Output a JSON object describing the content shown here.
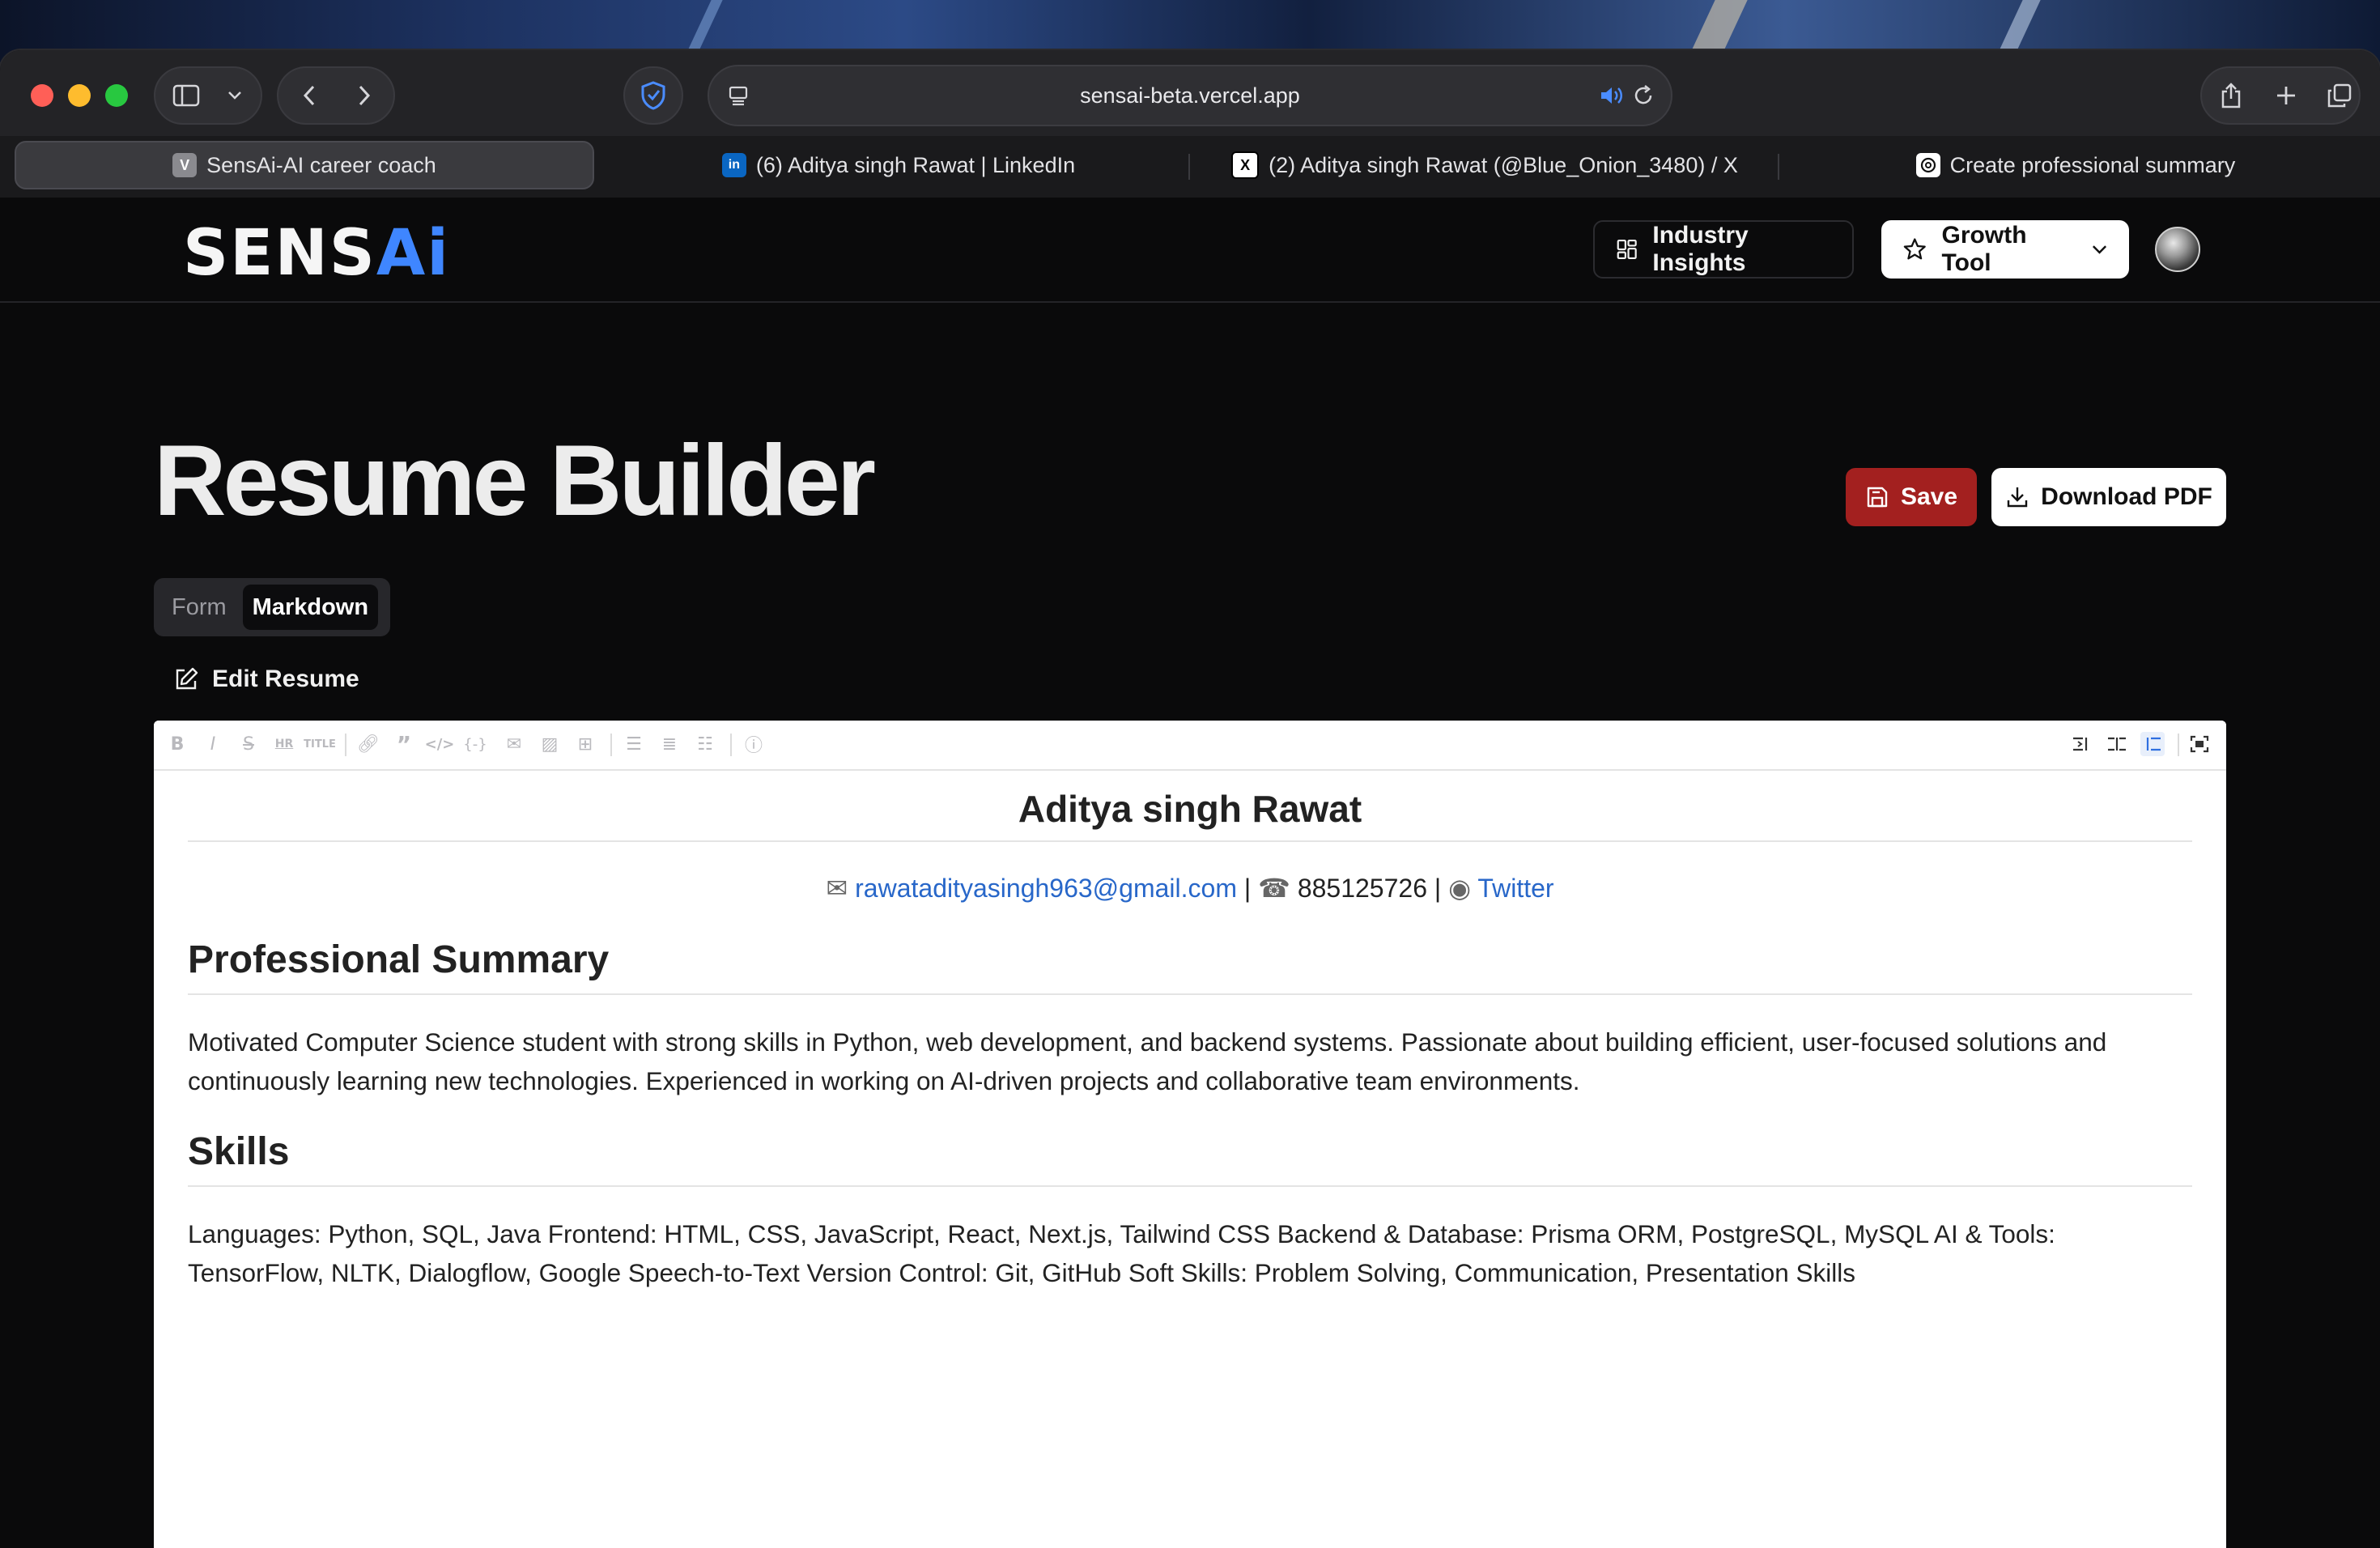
{
  "browser": {
    "url": "sensai-beta.vercel.app",
    "tabs": [
      {
        "label": "SensAi-AI career coach",
        "favicon": "V",
        "active": true
      },
      {
        "label": "(6) Aditya singh Rawat | LinkedIn",
        "favicon": "in",
        "active": false
      },
      {
        "label": "(2) Aditya singh Rawat (@Blue_Onion_3480) / X",
        "favicon": "X",
        "active": false
      },
      {
        "label": "Create professional summary",
        "favicon": "chatgpt-icon",
        "active": false
      }
    ]
  },
  "header": {
    "logo_main": "SENS",
    "logo_accent": "Ai",
    "industry_insights": "Industry Insights",
    "growth_tool": "Growth Tool"
  },
  "page": {
    "title": "Resume Builder",
    "save_label": "Save",
    "download_label": "Download PDF",
    "mode_tabs": [
      "Form",
      "Markdown"
    ],
    "active_mode": "Markdown",
    "edit_resume": "Edit Resume"
  },
  "resume": {
    "name": "Aditya singh Rawat",
    "email": "rawatadityasingh963@gmail.com",
    "phone": "885125726",
    "twitter": "Twitter",
    "sep": "|",
    "summary_heading": "Professional Summary",
    "summary_text": "Motivated Computer Science student with strong skills in Python, web development, and backend systems. Passionate about building efficient, user-focused solutions and continuously learning new technologies. Experienced in working on AI-driven projects and collaborative team environments.",
    "skills_heading": "Skills",
    "skills_text": "Languages: Python, SQL, Java Frontend: HTML, CSS, JavaScript, React, Next.js, Tailwind CSS Backend & Database: Prisma ORM, PostgreSQL, MySQL AI & Tools: TensorFlow, NLTK, Dialogflow, Google Speech-to-Text Version Control: Git, GitHub Soft Skills: Problem Solving, Communication, Presentation Skills"
  },
  "colors": {
    "save_button": "#a3201f",
    "link": "#2867c9",
    "logo_accent": "#3f86ff"
  }
}
